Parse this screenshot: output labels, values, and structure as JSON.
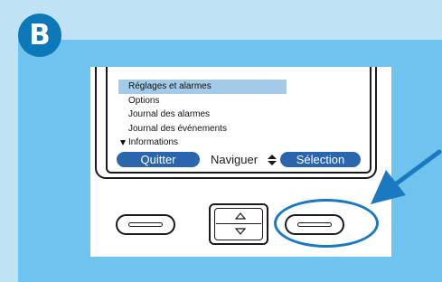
{
  "step": {
    "label": "B"
  },
  "screen": {
    "menu_items": [
      {
        "label": "Réglages et alarmes",
        "selected": true
      },
      {
        "label": "Options",
        "selected": false
      },
      {
        "label": "Journal des alarmes",
        "selected": false
      },
      {
        "label": "Journal des événements",
        "selected": false
      },
      {
        "label": "Informations",
        "selected": false,
        "more_indicator": "arrow-down-icon"
      }
    ],
    "softkeys": {
      "left_label": "Quitter",
      "center_label": "Naviguer",
      "center_icon": "updown-arrows-icon",
      "right_label": "Sélection"
    }
  },
  "hardware_buttons": {
    "left": "softkey-left-button",
    "center": "navigation-up-down-button",
    "right": "softkey-right-button",
    "highlighted": "softkey-right-button"
  },
  "colors": {
    "background_light": "#bfe3f5",
    "panel": "#6ec4ee",
    "badge": "#0d78b8",
    "softkey": "#2a65ad",
    "selection_highlight": "#a3cbe7",
    "annotation": "#1b79c0"
  }
}
